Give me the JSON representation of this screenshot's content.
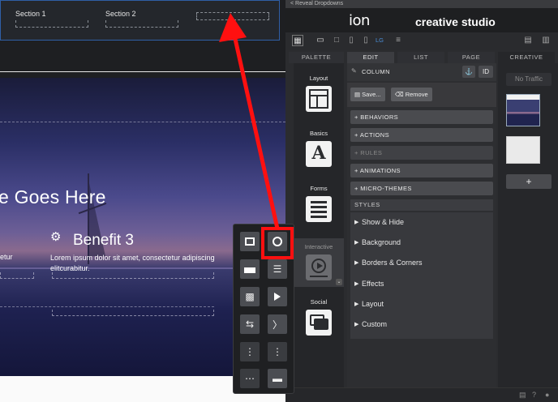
{
  "canvas": {
    "sections": [
      "Section 1",
      "Section 2"
    ],
    "headline": "e Goes Here",
    "benefit_title": "Benefit 3",
    "benefit_text": "Lorem ipsum dolor sit amet, consectetur adipiscing elitcurabitur.",
    "cut_text": "etur"
  },
  "panel": {
    "reveal_label": "< Reveal Dropdowns",
    "logo": "ion",
    "studio": "creative studio",
    "tabs": [
      "PALETTE",
      "EDIT",
      "LIST",
      "PAGE",
      "CREATIVE"
    ],
    "active_tab": "EDIT",
    "device_lg": "LG",
    "categories": [
      "Layout",
      "Basics",
      "Forms",
      "Interactive",
      "Social"
    ],
    "active_category": "Interactive",
    "edit": {
      "title": "COLUMN",
      "id_label": "ID",
      "save_label": "Save...",
      "remove_label": "Remove",
      "sections": [
        "+ BEHAVIORS",
        "+ ACTIONS",
        "+ RULES",
        "+ ANIMATIONS",
        "+ MICRO-THEMES"
      ],
      "styles_label": "STYLES",
      "styles": [
        "Show & Hide",
        "Background",
        "Borders & Corners",
        "Effects",
        "Layout",
        "Custom"
      ]
    },
    "page": {
      "traffic": "No Traffic",
      "add_label": "+"
    }
  },
  "colors": {
    "accent_blue": "#2f5fa6",
    "highlight_red": "#ff1010",
    "panel_bg": "#2b2c2f"
  }
}
